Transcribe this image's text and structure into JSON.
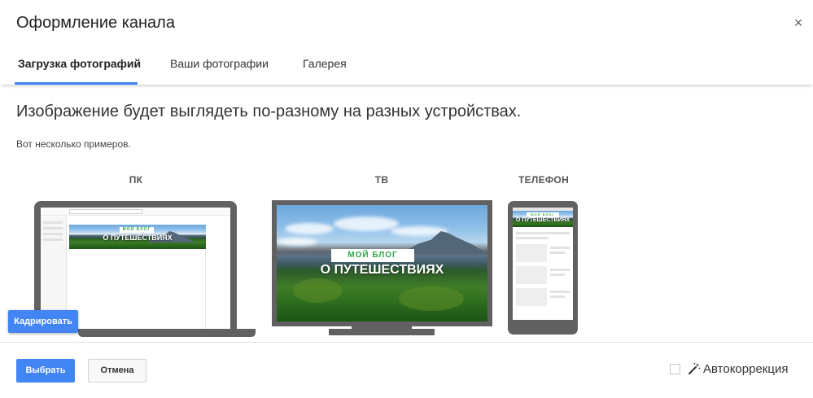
{
  "dialog": {
    "title": "Оформление канала",
    "close_symbol": "×"
  },
  "tabs": [
    {
      "label": "Загрузка фотографий",
      "active": true
    },
    {
      "label": "Ваши фотографии",
      "active": false
    },
    {
      "label": "Галерея",
      "active": false
    }
  ],
  "content": {
    "heading": "Изображение будет выглядеть по-разному на разных устройствах.",
    "subtext": "Вот несколько примеров."
  },
  "devices": {
    "pc_label": "ПК",
    "tv_label": "ТВ",
    "phone_label": "ТЕЛЕФОН"
  },
  "banner": {
    "top_text": "МОЙ БЛОГ",
    "main_text": "О ПУТЕШЕСТВИЯХ"
  },
  "buttons": {
    "crop": "Кадрировать",
    "select": "Выбрать",
    "cancel": "Отмена"
  },
  "autocorrect": {
    "label": "Автокоррекция",
    "checked": false,
    "icon": "magic-wand-icon"
  },
  "colors": {
    "accent": "#4285f4",
    "device_frame": "#616161",
    "banner_green_text": "#2da646"
  }
}
